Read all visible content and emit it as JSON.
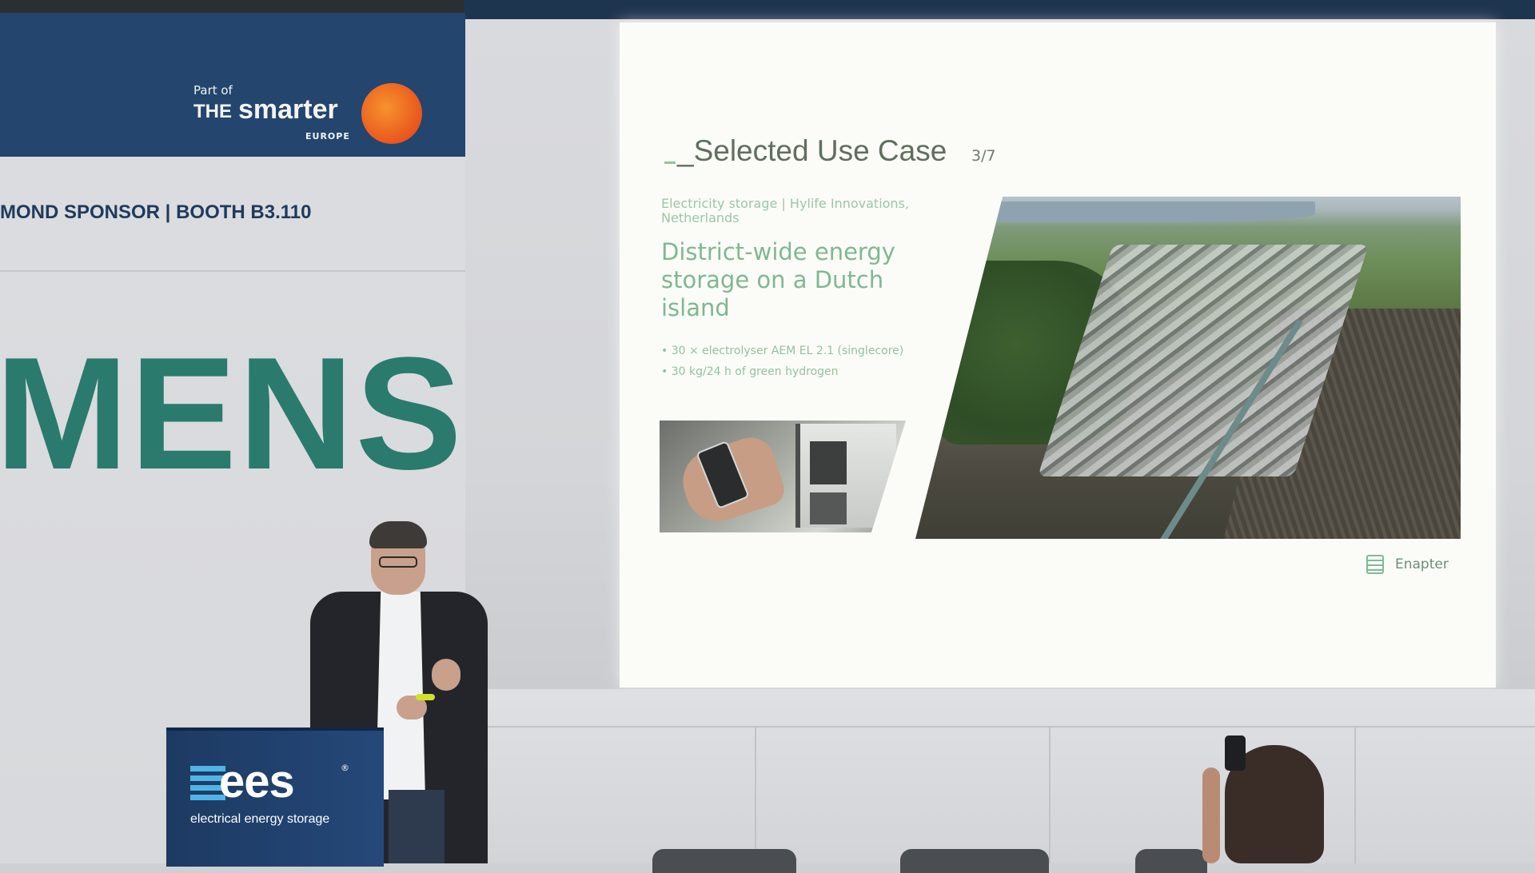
{
  "banner": {
    "part_of": "Part of",
    "the": "THE",
    "smarter": "smarter",
    "europe": "EUROPE",
    "sponsor_line": "MOND SPONSOR | BOOTH B3.110",
    "sponsor_word": "MENS",
    "sponsor_color": "#2a7a6e"
  },
  "slide": {
    "title": "_Selected Use Case",
    "counter": "3/7",
    "category": "Electricity storage | Hylife Innovations, Netherlands",
    "heading": "District-wide energy storage on a Dutch island",
    "bullets": [
      "30 × electrolyser AEM EL 2.1 (singlecore)",
      "30 kg/24 h of green hydrogen"
    ],
    "brand": "Enapter",
    "accent_color": "#7fb891"
  },
  "podium": {
    "logo_word": "ees",
    "logo_reg": "®",
    "logo_sub": "electrical energy storage"
  }
}
